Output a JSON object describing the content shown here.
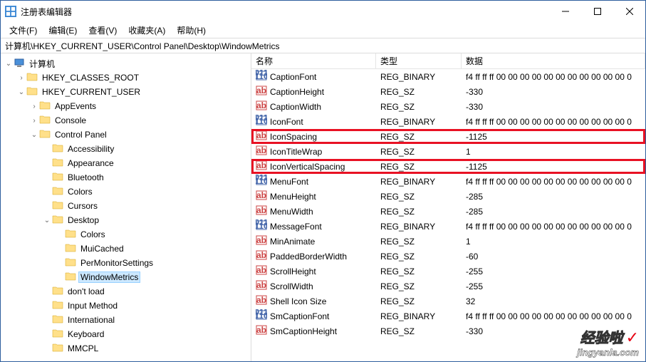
{
  "title": "注册表编辑器",
  "menubar": [
    "文件(F)",
    "编辑(E)",
    "查看(V)",
    "收藏夹(A)",
    "帮助(H)"
  ],
  "address": "计算机\\HKEY_CURRENT_USER\\Control Panel\\Desktop\\WindowMetrics",
  "tree": [
    {
      "depth": 0,
      "caret": "open",
      "icon": "computer",
      "label": "计算机"
    },
    {
      "depth": 1,
      "caret": "closed",
      "icon": "folder",
      "label": "HKEY_CLASSES_ROOT"
    },
    {
      "depth": 1,
      "caret": "open",
      "icon": "folder",
      "label": "HKEY_CURRENT_USER"
    },
    {
      "depth": 2,
      "caret": "closed",
      "icon": "folder",
      "label": "AppEvents"
    },
    {
      "depth": 2,
      "caret": "closed",
      "icon": "folder",
      "label": "Console"
    },
    {
      "depth": 2,
      "caret": "open",
      "icon": "folder",
      "label": "Control Panel"
    },
    {
      "depth": 3,
      "caret": "none",
      "icon": "folder",
      "label": "Accessibility"
    },
    {
      "depth": 3,
      "caret": "none",
      "icon": "folder",
      "label": "Appearance"
    },
    {
      "depth": 3,
      "caret": "none",
      "icon": "folder",
      "label": "Bluetooth"
    },
    {
      "depth": 3,
      "caret": "none",
      "icon": "folder",
      "label": "Colors"
    },
    {
      "depth": 3,
      "caret": "none",
      "icon": "folder",
      "label": "Cursors"
    },
    {
      "depth": 3,
      "caret": "open",
      "icon": "folder",
      "label": "Desktop"
    },
    {
      "depth": 4,
      "caret": "none",
      "icon": "folder",
      "label": "Colors"
    },
    {
      "depth": 4,
      "caret": "none",
      "icon": "folder",
      "label": "MuiCached"
    },
    {
      "depth": 4,
      "caret": "none",
      "icon": "folder",
      "label": "PerMonitorSettings"
    },
    {
      "depth": 4,
      "caret": "none",
      "icon": "folder",
      "label": "WindowMetrics",
      "selected": true
    },
    {
      "depth": 3,
      "caret": "none",
      "icon": "folder",
      "label": "don't load"
    },
    {
      "depth": 3,
      "caret": "none",
      "icon": "folder",
      "label": "Input Method"
    },
    {
      "depth": 3,
      "caret": "none",
      "icon": "folder",
      "label": "International"
    },
    {
      "depth": 3,
      "caret": "none",
      "icon": "folder",
      "label": "Keyboard"
    },
    {
      "depth": 3,
      "caret": "none",
      "icon": "folder",
      "label": "MMCPL"
    }
  ],
  "columns": {
    "name": "名称",
    "type": "类型",
    "data": "数据"
  },
  "values": [
    {
      "icon": "bin",
      "name": "CaptionFont",
      "type": "REG_BINARY",
      "data": "f4 ff ff ff 00 00 00 00 00 00 00 00 00 00 00 0"
    },
    {
      "icon": "str",
      "name": "CaptionHeight",
      "type": "REG_SZ",
      "data": "-330"
    },
    {
      "icon": "str",
      "name": "CaptionWidth",
      "type": "REG_SZ",
      "data": "-330"
    },
    {
      "icon": "bin",
      "name": "IconFont",
      "type": "REG_BINARY",
      "data": "f4 ff ff ff 00 00 00 00 00 00 00 00 00 00 00 0"
    },
    {
      "icon": "str",
      "name": "IconSpacing",
      "type": "REG_SZ",
      "data": "-1125",
      "hl": true
    },
    {
      "icon": "str",
      "name": "IconTitleWrap",
      "type": "REG_SZ",
      "data": "1"
    },
    {
      "icon": "str",
      "name": "IconVerticalSpacing",
      "type": "REG_SZ",
      "data": "-1125",
      "hl": true
    },
    {
      "icon": "bin",
      "name": "MenuFont",
      "type": "REG_BINARY",
      "data": "f4 ff ff ff 00 00 00 00 00 00 00 00 00 00 00 0"
    },
    {
      "icon": "str",
      "name": "MenuHeight",
      "type": "REG_SZ",
      "data": "-285"
    },
    {
      "icon": "str",
      "name": "MenuWidth",
      "type": "REG_SZ",
      "data": "-285"
    },
    {
      "icon": "bin",
      "name": "MessageFont",
      "type": "REG_BINARY",
      "data": "f4 ff ff ff 00 00 00 00 00 00 00 00 00 00 00 0"
    },
    {
      "icon": "str",
      "name": "MinAnimate",
      "type": "REG_SZ",
      "data": "1"
    },
    {
      "icon": "str",
      "name": "PaddedBorderWidth",
      "type": "REG_SZ",
      "data": "-60"
    },
    {
      "icon": "str",
      "name": "ScrollHeight",
      "type": "REG_SZ",
      "data": "-255"
    },
    {
      "icon": "str",
      "name": "ScrollWidth",
      "type": "REG_SZ",
      "data": "-255"
    },
    {
      "icon": "str",
      "name": "Shell Icon Size",
      "type": "REG_SZ",
      "data": "32"
    },
    {
      "icon": "bin",
      "name": "SmCaptionFont",
      "type": "REG_BINARY",
      "data": "f4 ff ff ff 00 00 00 00 00 00 00 00 00 00 00 0"
    },
    {
      "icon": "str",
      "name": "SmCaptionHeight",
      "type": "REG_SZ",
      "data": "-330"
    }
  ],
  "watermark": {
    "line1": "经验啦",
    "line2": "jingyanla.com"
  }
}
